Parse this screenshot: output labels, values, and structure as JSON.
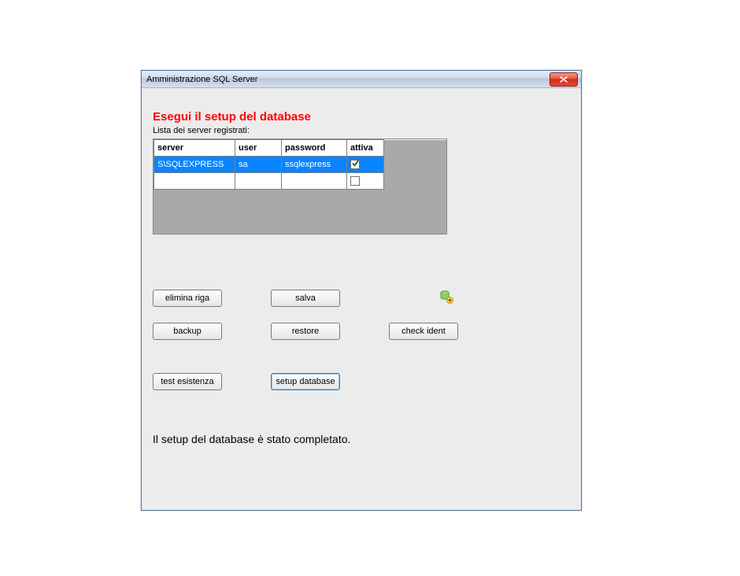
{
  "window": {
    "title": "Amministrazione SQL Server"
  },
  "header": {
    "setup_title": "Esegui il setup del database",
    "subtitle": "Lista dei server registrati:"
  },
  "table": {
    "columns": {
      "server": "server",
      "user": "user",
      "password": "password",
      "attiva": "attiva"
    },
    "rows": [
      {
        "server": "S\\SQLEXPRESS",
        "user": "sa",
        "password": "ssqlexpress",
        "attiva": true,
        "selected": true
      },
      {
        "server": "",
        "user": "",
        "password": "",
        "attiva": false,
        "selected": false
      }
    ]
  },
  "buttons": {
    "elimina_riga": "elimina riga",
    "salva": "salva",
    "backup": "backup",
    "restore": "restore",
    "check_ident": "check ident",
    "test_esistenza": "test esistenza",
    "setup_database": "setup database"
  },
  "status": "Il setup del database è stato completato."
}
